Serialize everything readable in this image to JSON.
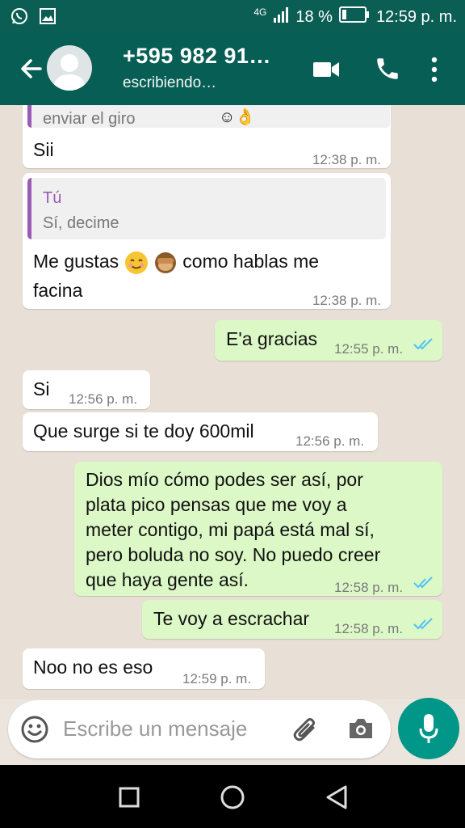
{
  "status_bar": {
    "network": "4G",
    "battery": "18 %",
    "time": "12:59 p. m."
  },
  "header": {
    "contact_name": "+595 982 91…",
    "contact_status": "escribiendo…"
  },
  "messages": [
    {
      "direction": "in",
      "quote_tail": "enviar el giro",
      "text": "Sii",
      "time": "12:38 p. m."
    },
    {
      "direction": "in",
      "quote_name": "Tú",
      "quote_text": "Sí, decime",
      "text_part1": "Me gustas",
      "text_part2": "como hablas me",
      "text_part3": "facina",
      "time": "12:38 p. m."
    },
    {
      "direction": "out",
      "text": "E'a gracias",
      "time": "12:55 p. m.",
      "status": "read"
    },
    {
      "direction": "in",
      "text": "Si",
      "time": "12:56 p. m."
    },
    {
      "direction": "in",
      "text": "Que surge si te doy 600mil",
      "time": "12:56 p. m."
    },
    {
      "direction": "out",
      "lines": [
        "Dios mío cómo podes ser así, por",
        "plata pico pensas que me voy a",
        "meter contigo, mi papá está mal sí,",
        "pero boluda no soy. No puedo creer",
        "que haya gente así."
      ],
      "time": "12:58 p. m.",
      "status": "read"
    },
    {
      "direction": "out",
      "text": "Te voy a escrachar",
      "time": "12:58 p. m.",
      "status": "read"
    },
    {
      "direction": "in",
      "text": "Noo no es eso",
      "time": "12:59 p. m."
    }
  ],
  "composer": {
    "placeholder": "Escribe un mensaje"
  },
  "icons": {
    "status_left": [
      "whatsapp-icon",
      "gallery-icon"
    ],
    "status_right": [
      "signal-icon",
      "battery-icon"
    ],
    "toolbar": [
      "back-arrow-icon",
      "avatar-icon",
      "video-call-icon",
      "phone-icon",
      "more-vert-icon"
    ],
    "composer": [
      "emoji-icon",
      "attach-icon",
      "camera-icon",
      "mic-icon"
    ],
    "nav": [
      "recents-icon",
      "home-icon",
      "back-icon"
    ]
  },
  "colors": {
    "header": "#075e54",
    "outgoing_bubble": "#dcf8c6",
    "incoming_bubble": "#ffffff",
    "read_ticks": "#4fc3f7",
    "accent": "#009688"
  }
}
